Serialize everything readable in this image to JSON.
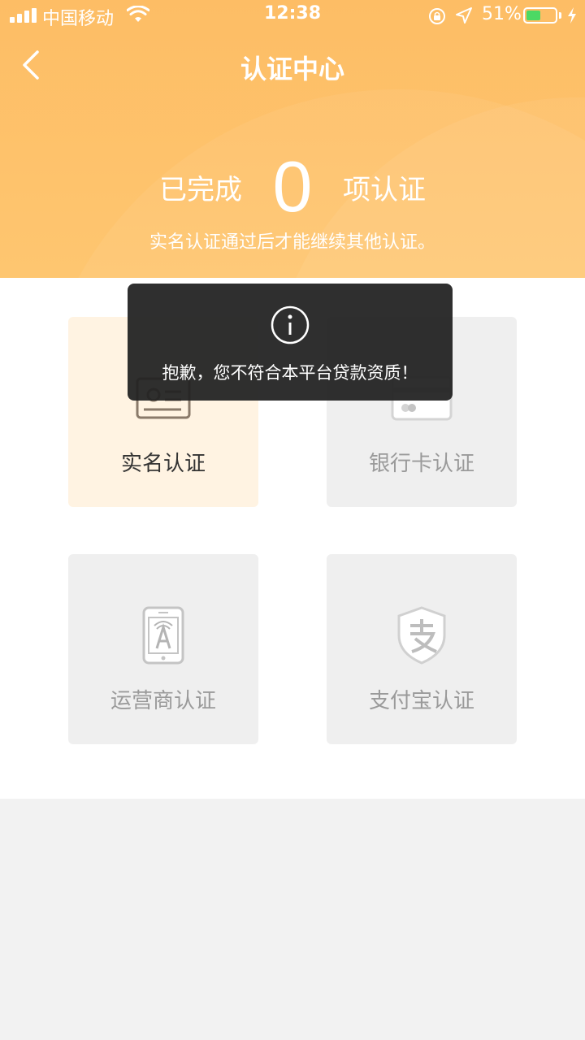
{
  "status_bar": {
    "carrier": "中国移动",
    "time": "12:38",
    "battery_percent": "51%",
    "battery_level": 0.51,
    "battery_color": "#4cd964"
  },
  "nav": {
    "title": "认证中心",
    "back_icon": "chevron-left-icon"
  },
  "summary": {
    "prefix": "已完成",
    "count": "0",
    "suffix": "项认证",
    "notice": "实名认证通过后才能继续其他认证。"
  },
  "cards": [
    {
      "label": "实名认证",
      "icon": "id-card-icon",
      "active": true
    },
    {
      "label": "银行卡认证",
      "icon": "bank-card-icon",
      "active": false
    },
    {
      "label": "运营商认证",
      "icon": "phone-tower-icon",
      "active": false
    },
    {
      "label": "支付宝认证",
      "icon": "alipay-shield-icon",
      "active": false
    }
  ],
  "toast": {
    "icon": "info-icon",
    "message": "抱歉，您不符合本平台贷款资质！"
  },
  "colors": {
    "accent": "#fdbd65",
    "active_card_bg": "#fff3e2",
    "inactive_card_bg": "#efefef"
  }
}
